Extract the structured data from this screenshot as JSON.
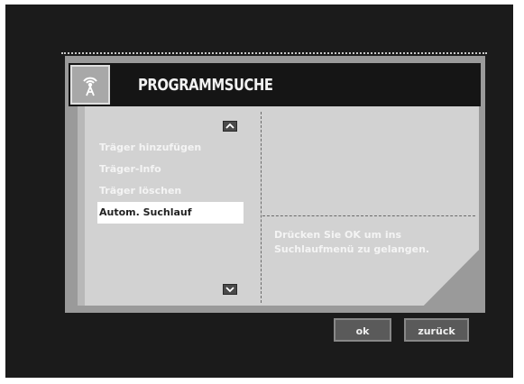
{
  "header": {
    "title": "PROGRAMMSUCHE",
    "icon": "antenna-icon"
  },
  "menu": {
    "items": [
      {
        "label": "Träger hinzufügen"
      },
      {
        "label": "Träger-Info"
      },
      {
        "label": "Träger löschen"
      },
      {
        "label": "Autom. Suchlauf",
        "selected": true
      }
    ]
  },
  "info": {
    "text": "Drücken Sie OK um ins Suchlaufmenü zu gelangen."
  },
  "buttons": {
    "ok": "ok",
    "back": "zurück"
  },
  "colors": {
    "background": "#1b1b1b",
    "panel": "#d2d2d2",
    "titlebar": "#151515",
    "selected": "#ffffff"
  }
}
